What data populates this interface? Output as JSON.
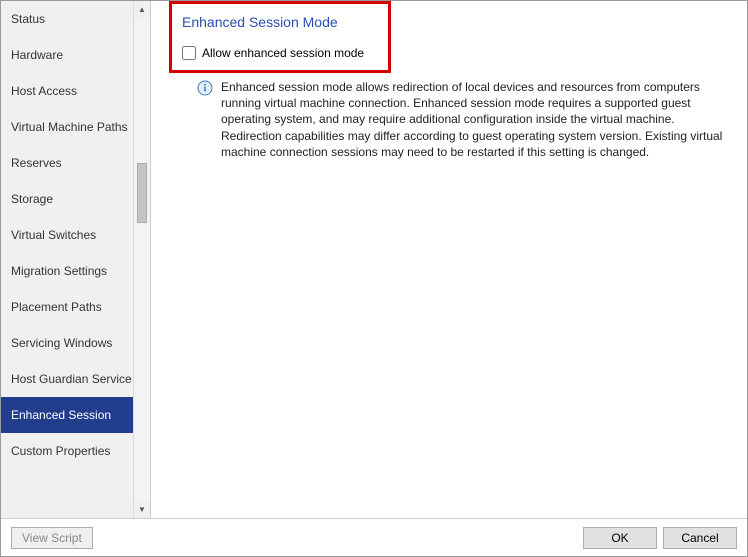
{
  "sidebar": {
    "items": [
      {
        "label": "Status"
      },
      {
        "label": "Hardware"
      },
      {
        "label": "Host Access"
      },
      {
        "label": "Virtual Machine Paths"
      },
      {
        "label": "Reserves"
      },
      {
        "label": "Storage"
      },
      {
        "label": "Virtual Switches"
      },
      {
        "label": "Migration Settings"
      },
      {
        "label": "Placement Paths"
      },
      {
        "label": "Servicing Windows"
      },
      {
        "label": "Host Guardian Service"
      },
      {
        "label": "Enhanced Session"
      },
      {
        "label": "Custom Properties"
      }
    ],
    "selected_index": 11
  },
  "content": {
    "title": "Enhanced Session Mode",
    "checkbox_label": "Allow enhanced session mode",
    "checkbox_checked": false,
    "description": "Enhanced session mode allows redirection of local devices and resources from computers running virtual machine connection. Enhanced session mode requires a supported guest operating system, and may require additional configuration inside the virtual machine. Redirection capabilities may differ according to guest operating system version. Existing virtual machine connection sessions may need to be restarted if this setting is changed."
  },
  "footer": {
    "view_script": "View Script",
    "ok": "OK",
    "cancel": "Cancel"
  }
}
